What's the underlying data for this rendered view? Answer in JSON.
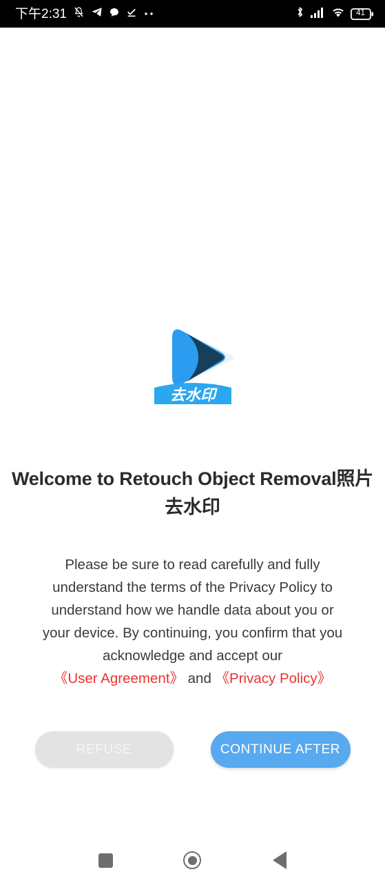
{
  "status_bar": {
    "time": "下午2:31",
    "left_icons": [
      "bell-muted-icon",
      "send-icon",
      "chat-bubble-icon",
      "check-underline-icon",
      "more-dots-icon"
    ],
    "right_icons": [
      "bluetooth-icon",
      "cellular-signal-icon",
      "wifi-icon",
      "battery-icon"
    ],
    "battery_level": "41",
    "background_color": "#000000",
    "foreground_color": "#ffffff"
  },
  "app": {
    "logo_name": "retouch-app-logo",
    "logo_banner_text": "去水印",
    "logo_colors": {
      "blue": "#2b9cf0",
      "navy": "#16374f",
      "light_gray": "#eef1f5",
      "banner": "#2ba7ef"
    }
  },
  "dialog": {
    "title": "Welcome to Retouch Object Removal照片去水印",
    "paragraph_part1": "Please be sure to read carefully and fully understand the terms of the Privacy Policy to understand how we handle data about you or your device. By continuing, you confirm that you acknowledge and accept our  ",
    "user_agreement_link": "《User Agreement》",
    "conjunction": "  and  ",
    "privacy_policy_link": "《Privacy Policy》",
    "link_color": "#e8342c",
    "refuse_label": "REFUSE",
    "continue_label": "CONTINUE AFTER",
    "refuse_color": "#e3e3e3",
    "continue_color": "#57a9f0"
  },
  "nav_bar": {
    "recents_label": "recents-square",
    "home_label": "home-circle",
    "back_label": "back-triangle",
    "icon_color": "#6e6e6e"
  }
}
